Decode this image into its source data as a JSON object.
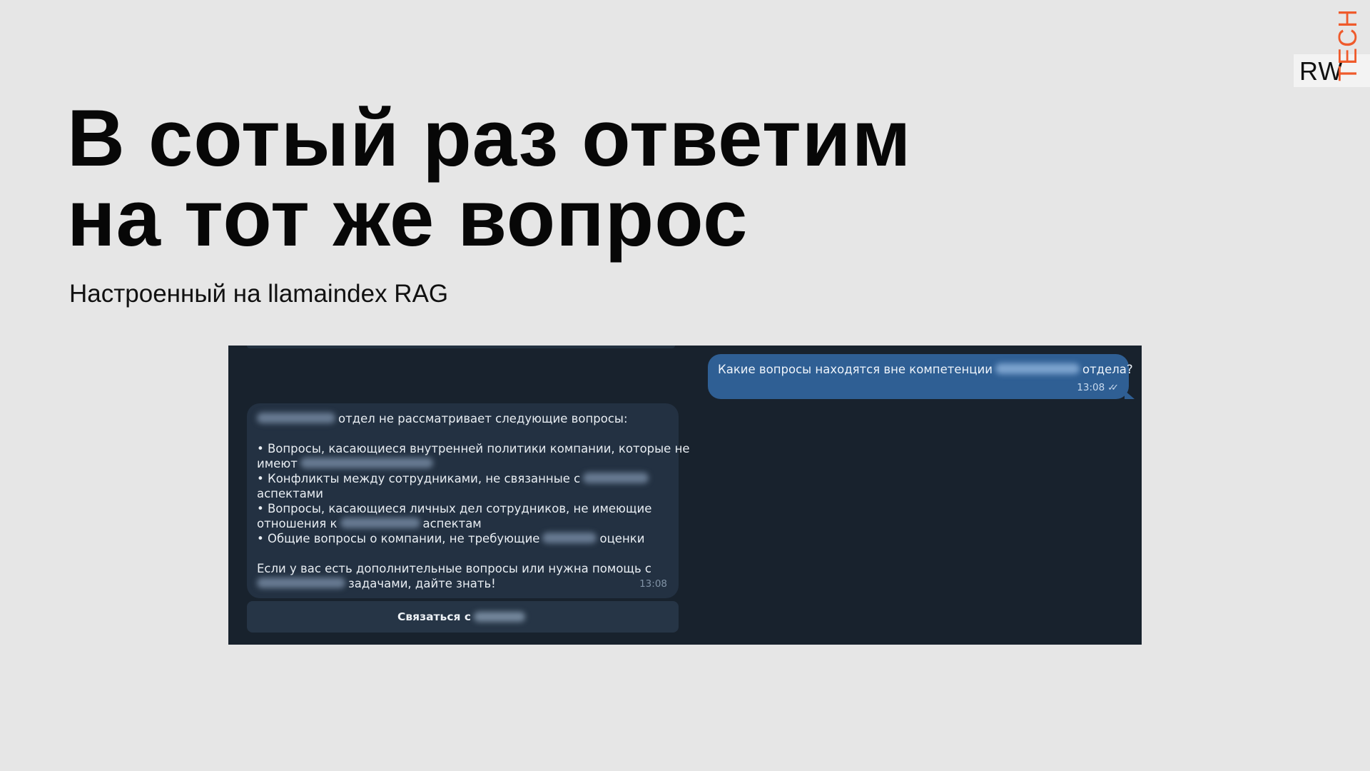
{
  "logo": {
    "rw": "RW",
    "tech": "TECH",
    "colors": {
      "tech": "#ef5a2b"
    }
  },
  "slide": {
    "title_line_1": "В сотый раз ответим",
    "title_line_2": "на тот же вопрос",
    "subtitle": "Настроенный на llamaindex RAG"
  },
  "chat": {
    "outgoing": {
      "text_before": "Какие вопросы находятся вне компетенции",
      "text_after": "отдела?",
      "time": "13:08",
      "status_icon": "double-check-icon"
    },
    "incoming": {
      "line_1": "отдел не рассматривает следующие вопросы:",
      "bullet_1_a": "• Вопросы, касающиеся внутренней политики компании, которые не",
      "bullet_1_b": "имеют",
      "bullet_2_a": "• Конфликты между сотрудниками, не связанные с",
      "bullet_2_b": "аспектами",
      "bullet_3_a": "• Вопросы, касающиеся личных дел сотрудников, не имеющие",
      "bullet_3_b_before": "отношения к",
      "bullet_3_b_after": "аспектам",
      "bullet_4_before": "• Общие вопросы о компании, не требующие",
      "bullet_4_after": "оценки",
      "closing_a": "Если у вас есть дополнительные вопросы или нужна помощь с",
      "closing_b": "задачами, дайте знать!",
      "time": "13:08"
    },
    "button_label": "Связаться с",
    "colors": {
      "background": "#18222d",
      "outgoing_bubble": "#2f5f94",
      "incoming_bubble": "#233142"
    }
  }
}
